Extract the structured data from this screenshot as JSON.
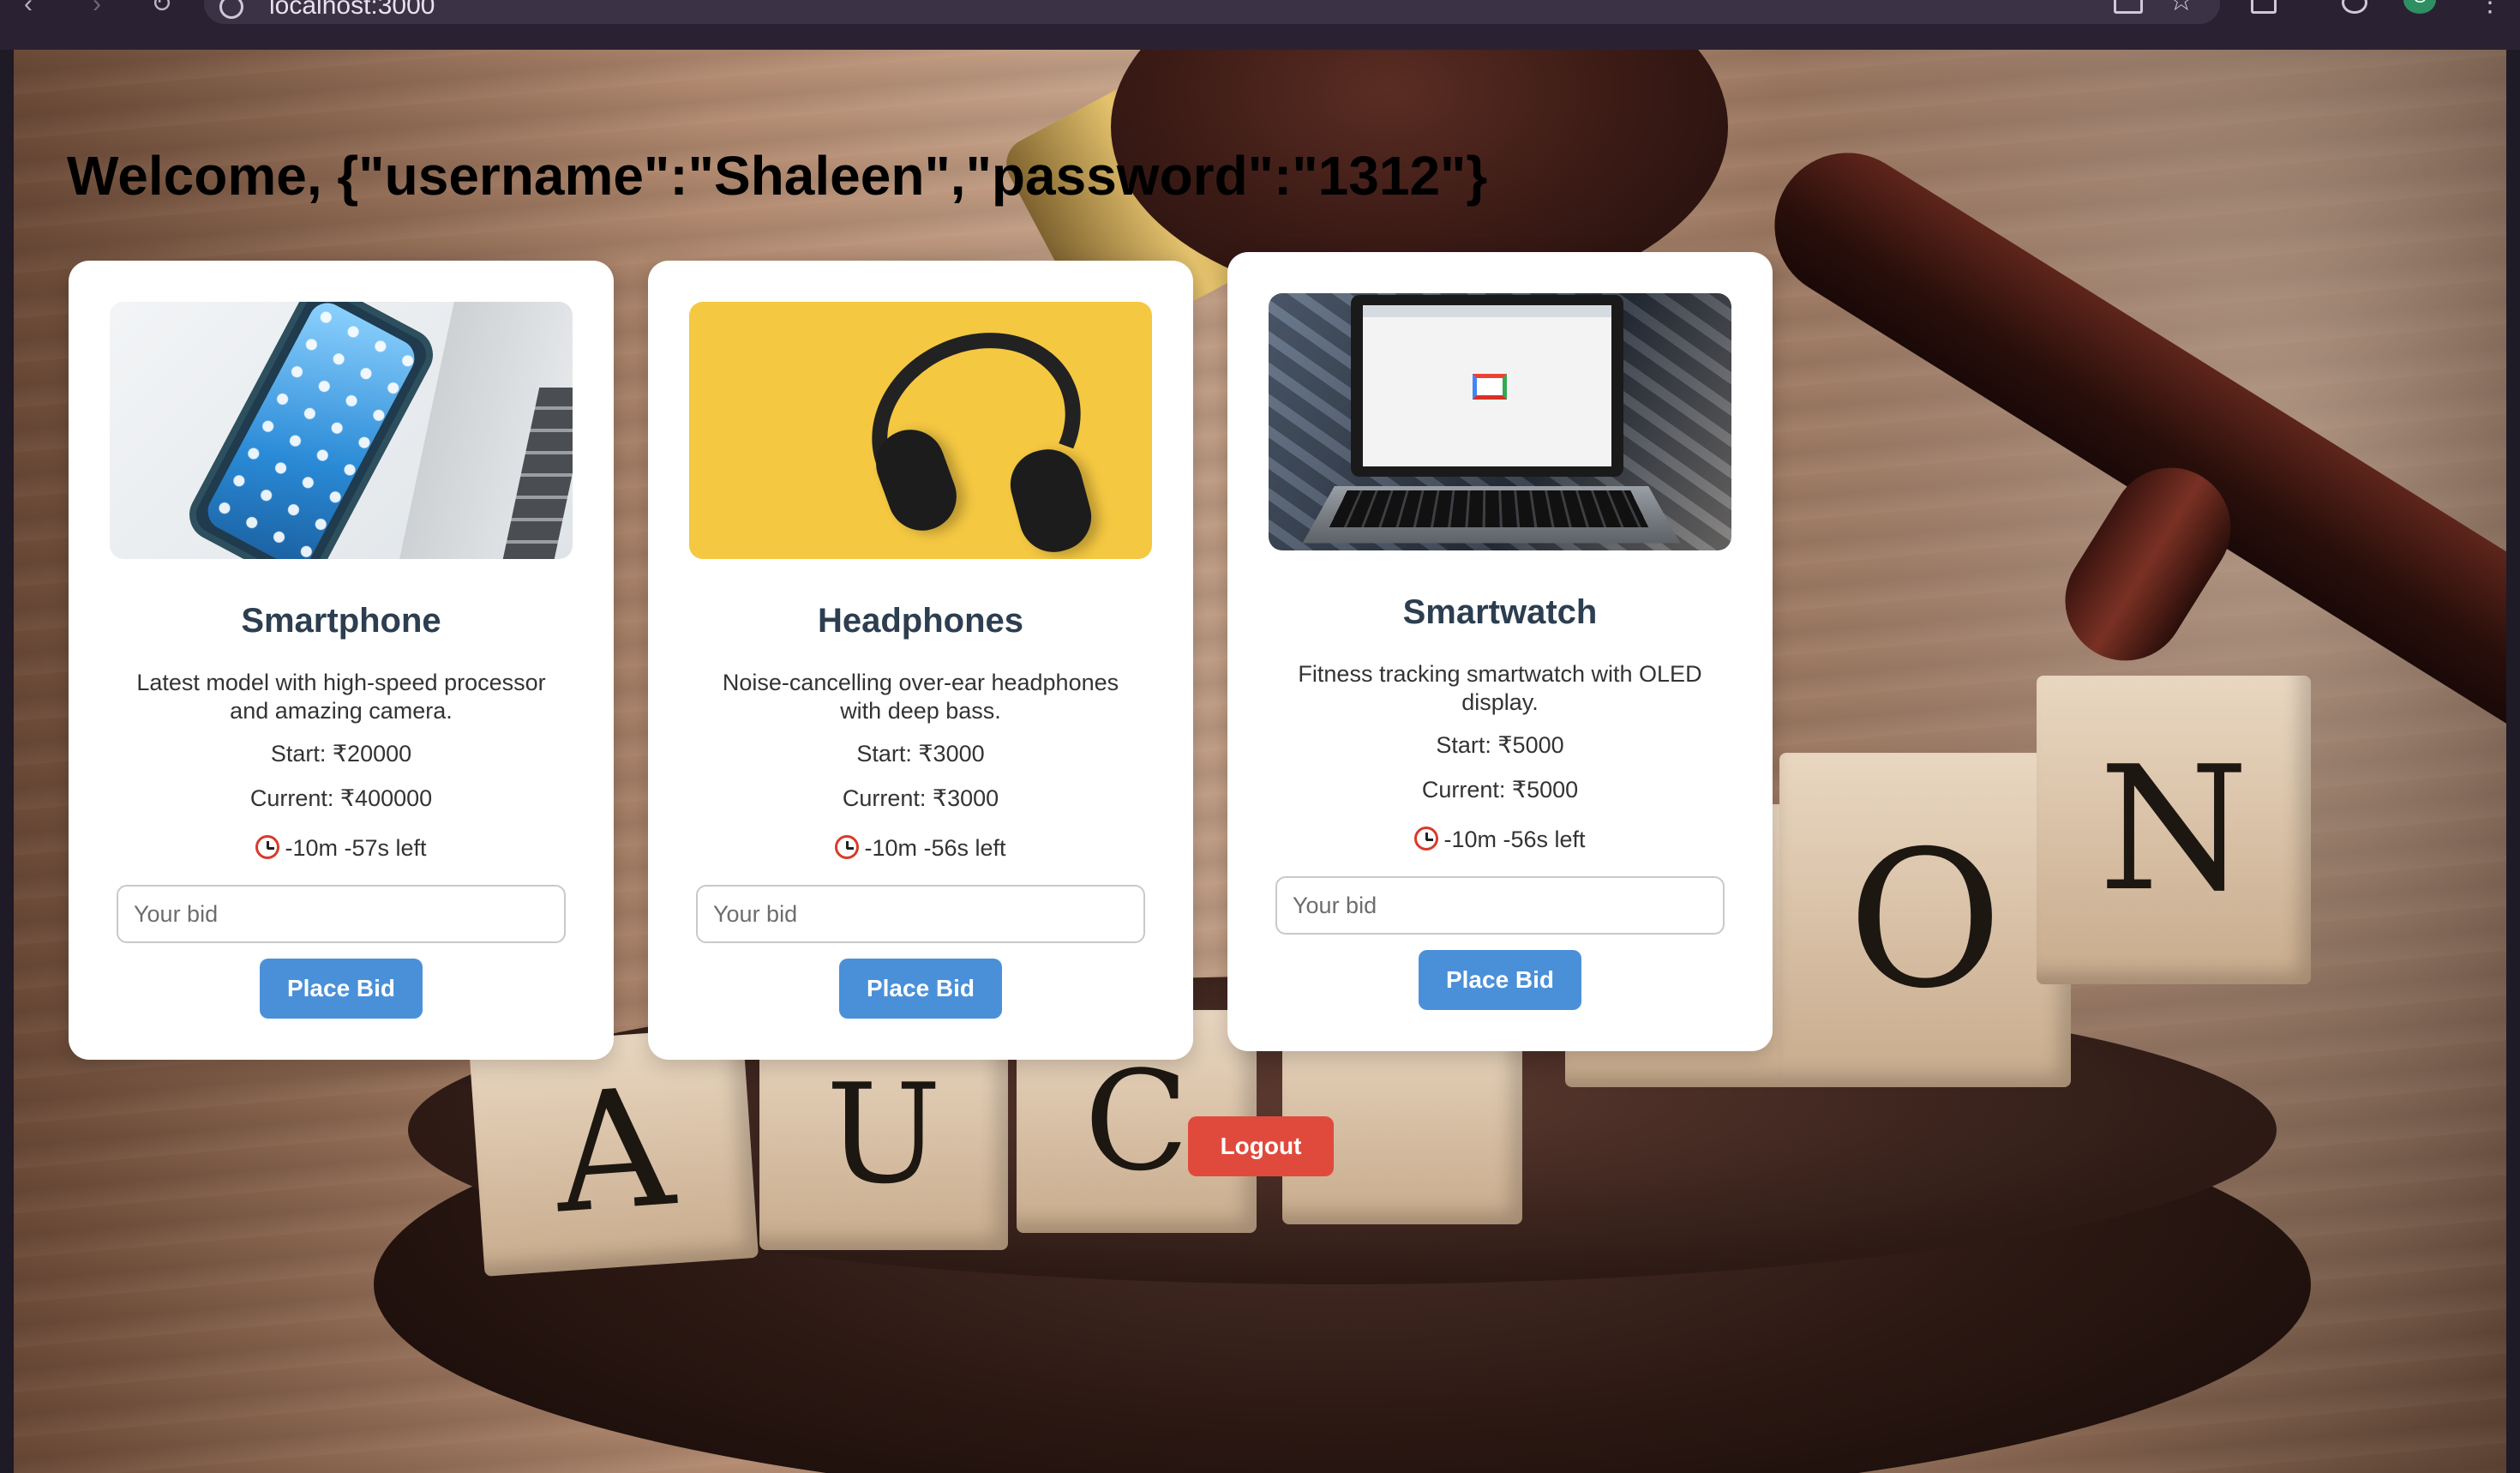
{
  "browser": {
    "url": "localhost:3000",
    "avatar_letter": "G"
  },
  "page": {
    "welcome": "Welcome, {\"username\":\"Shaleen\",\"password\":\"1312\"}",
    "logout_label": "Logout"
  },
  "background": {
    "tiles": [
      "A",
      "U",
      "C",
      "O",
      "N"
    ]
  },
  "items": [
    {
      "title": "Smartphone",
      "description": "Latest model with high-speed processor and amazing camera.",
      "start": "Start: ₹20000",
      "current": "Current: ₹400000",
      "time_left": "-10m -57s left",
      "bid_placeholder": "Your bid",
      "bid_label": "Place Bid",
      "image_icon": "smartphone-photo"
    },
    {
      "title": "Headphones",
      "description": "Noise-cancelling over-ear headphones with deep bass.",
      "start": "Start: ₹3000",
      "current": "Current: ₹3000",
      "time_left": "-10m -56s left",
      "bid_placeholder": "Your bid",
      "bid_label": "Place Bid",
      "image_icon": "headphones-photo"
    },
    {
      "title": "Smartwatch",
      "description": "Fitness tracking smartwatch with OLED display.",
      "start": "Start: ₹5000",
      "current": "Current: ₹5000",
      "time_left": "-10m -56s left",
      "bid_placeholder": "Your bid",
      "bid_label": "Place Bid",
      "image_icon": "laptop-photo"
    }
  ],
  "colors": {
    "bid_button": "#4a90d9",
    "logout_button": "#e04a3c",
    "card_title": "#2c3e50"
  }
}
